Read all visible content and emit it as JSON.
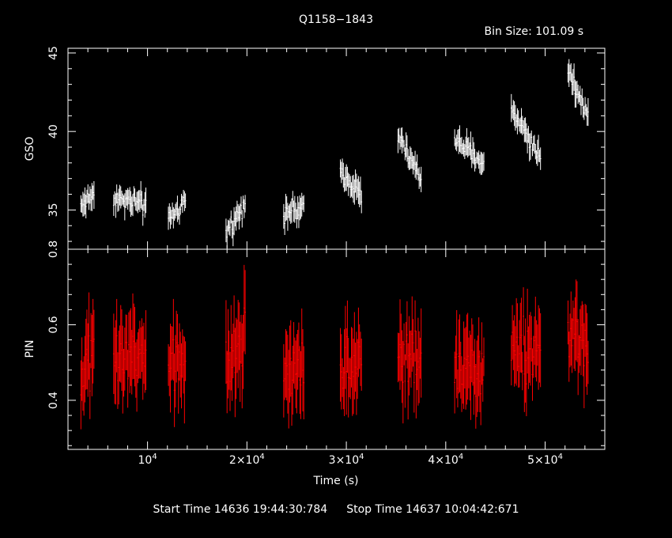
{
  "chart_data": {
    "type": "scatter",
    "title": "Q1158−1843",
    "bin_size_label": "Bin Size: 101.09 s",
    "xlabel": "Time (s)",
    "xlim": [
      2000,
      56000
    ],
    "x_ticks": [
      {
        "value": 10000,
        "label": "10^4"
      },
      {
        "value": 20000,
        "label": "2×10^4"
      },
      {
        "value": 30000,
        "label": "3×10^4"
      },
      {
        "value": 40000,
        "label": "4×10^4"
      },
      {
        "value": 50000,
        "label": "5×10^4"
      }
    ],
    "panels": [
      {
        "name": "GSO",
        "ylabel": "GSO",
        "ylim": [
          32.5,
          45.3
        ],
        "y_ticks": [
          35,
          40,
          45
        ],
        "color": "#ffffff",
        "segments": [
          {
            "t0": 3300,
            "t1": 4700,
            "y0": 35.3,
            "y1": 36.0
          },
          {
            "t0": 6600,
            "t1": 9900,
            "y0": 35.8,
            "y1": 35.3
          },
          {
            "t0": 12100,
            "t1": 13900,
            "y0": 34.3,
            "y1": 35.5
          },
          {
            "t0": 17900,
            "t1": 19900,
            "y0": 33.5,
            "y1": 35.5
          },
          {
            "t0": 23700,
            "t1": 25800,
            "y0": 34.9,
            "y1": 35.0
          },
          {
            "t0": 29400,
            "t1": 31600,
            "y0": 37.6,
            "y1": 36.0
          },
          {
            "t0": 35200,
            "t1": 37600,
            "y0": 39.6,
            "y1": 37.0
          },
          {
            "t0": 40900,
            "t1": 43900,
            "y0": 39.5,
            "y1": 37.9
          },
          {
            "t0": 46600,
            "t1": 49600,
            "y0": 41.5,
            "y1": 38.3
          },
          {
            "t0": 52300,
            "t1": 54400,
            "y0": 44.0,
            "y1": 41.0
          }
        ]
      },
      {
        "name": "PIN",
        "ylabel": "PIN",
        "ylim": [
          0.27,
          0.8
        ],
        "y_ticks": [
          0.4,
          0.6,
          0.8
        ],
        "color": "#ff0000",
        "segments": [
          {
            "t0": 3300,
            "t1": 4700,
            "y0": 0.44,
            "y1": 0.55
          },
          {
            "t0": 6600,
            "t1": 9900,
            "y0": 0.5,
            "y1": 0.52
          },
          {
            "t0": 12100,
            "t1": 13900,
            "y0": 0.47,
            "y1": 0.5
          },
          {
            "t0": 17900,
            "t1": 19900,
            "y0": 0.47,
            "y1": 0.58
          },
          {
            "t0": 23700,
            "t1": 25800,
            "y0": 0.48,
            "y1": 0.5
          },
          {
            "t0": 29400,
            "t1": 31600,
            "y0": 0.48,
            "y1": 0.5
          },
          {
            "t0": 35200,
            "t1": 37600,
            "y0": 0.52,
            "y1": 0.48
          },
          {
            "t0": 40900,
            "t1": 43900,
            "y0": 0.5,
            "y1": 0.46
          },
          {
            "t0": 46600,
            "t1": 49600,
            "y0": 0.54,
            "y1": 0.52
          },
          {
            "t0": 52300,
            "t1": 54400,
            "y0": 0.6,
            "y1": 0.54
          }
        ]
      }
    ]
  },
  "footer": {
    "start": "Start Time 14636 19:44:30:784",
    "stop": "Stop Time 14637 10:04:42:671"
  }
}
